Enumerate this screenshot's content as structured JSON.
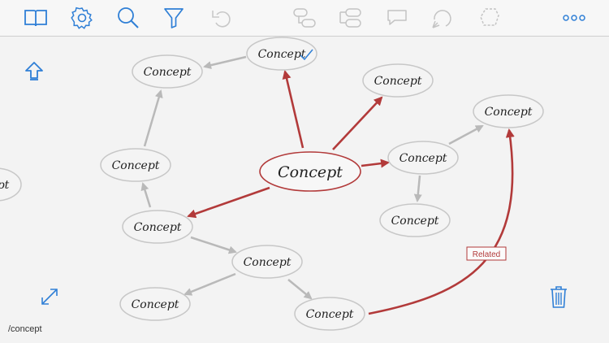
{
  "toolbar": {
    "left_icons": [
      "book-icon",
      "gear-icon",
      "search-icon",
      "filter-icon",
      "undo-icon"
    ],
    "center_icons": [
      "add-child-icon",
      "add-sibling-icon",
      "add-comment-icon",
      "add-relation-icon",
      "lasso-icon"
    ],
    "more_icon": "more-icon"
  },
  "colors": {
    "accent": "#2f7fd6",
    "relation": "#b23a3a",
    "connector": "#b9b9b9",
    "node_border": "#c7c7c7",
    "node_fill": "#f4f4f4"
  },
  "map": {
    "central": {
      "label": "Concept"
    },
    "nodes": [
      {
        "id": "n1",
        "label": "Concept"
      },
      {
        "id": "n2",
        "label": "Concept"
      },
      {
        "id": "n3",
        "label": "Concept"
      },
      {
        "id": "n4",
        "label": "Concept"
      },
      {
        "id": "n5",
        "label": "Concept"
      },
      {
        "id": "n6",
        "label": "Concept"
      },
      {
        "id": "n7",
        "label": "Concept"
      },
      {
        "id": "n8",
        "label": "Concept"
      },
      {
        "id": "n9",
        "label": "Concept"
      },
      {
        "id": "n10",
        "label": "Concept"
      },
      {
        "id": "n11",
        "label": "Concept"
      },
      {
        "id": "n12",
        "label": "pt"
      }
    ],
    "relation_label": "Related"
  },
  "path": "/concept"
}
